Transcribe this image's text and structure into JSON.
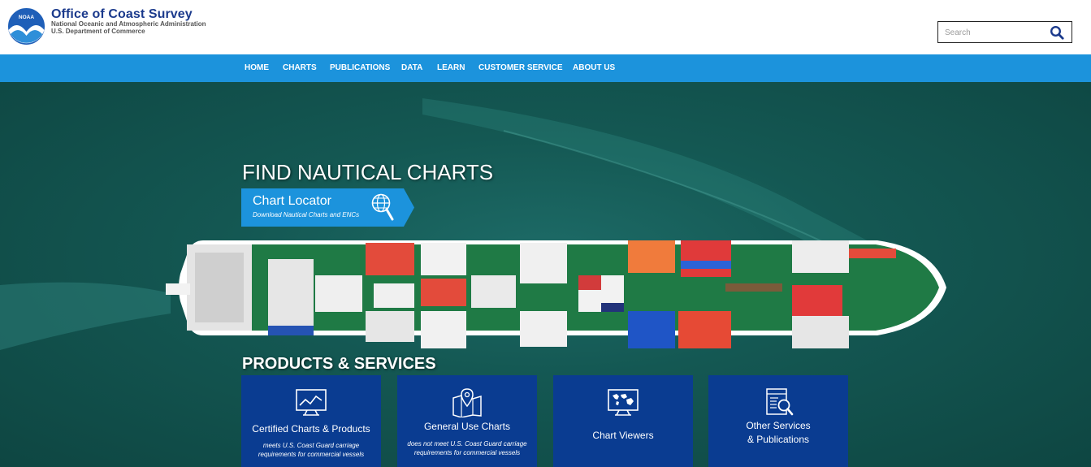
{
  "header": {
    "logo_text": "NOAA",
    "title": "Office of Coast Survey",
    "subtitle_line1": "National Oceanic and Atmospheric Administration",
    "subtitle_line2": "U.S. Department of Commerce",
    "search": {
      "placeholder": "Search",
      "value": "",
      "icon": "search-icon"
    }
  },
  "nav": {
    "items": [
      {
        "label": "HOME"
      },
      {
        "label": "CHARTS"
      },
      {
        "label": "PUBLICATIONS"
      },
      {
        "label": "DATA"
      },
      {
        "label": "LEARN"
      },
      {
        "label": "CUSTOMER SERVICE"
      },
      {
        "label": "ABOUT US"
      }
    ]
  },
  "hero": {
    "heading": "FIND NAUTICAL CHARTS",
    "locator": {
      "title": "Chart Locator",
      "subtitle": "Download Nautical Charts and ENCs",
      "icon": "globe-magnifier-icon"
    }
  },
  "products": {
    "heading": "PRODUCTS & SERVICES",
    "cards": [
      {
        "title": "Certified Charts & Products",
        "desc": "meets U.S. Coast Guard carriage requirements for commercial vessels",
        "icon": "monitor-chart-icon"
      },
      {
        "title": "General Use Charts",
        "desc": "does not meet U.S. Coast Guard carriage requirements for commercial vessels",
        "icon": "map-pin-icon"
      },
      {
        "title": "Chart Viewers",
        "desc": "",
        "icon": "monitor-world-icon"
      },
      {
        "title_line1": "Other Services",
        "title_line2": "& Publications",
        "desc": "",
        "icon": "document-search-icon"
      }
    ]
  },
  "colors": {
    "brand_blue": "#1b3a8c",
    "nav_bg": "#1c93dc",
    "locator_bg": "#1c93dc",
    "card_bg": "#0a3c91",
    "water": "#145853"
  }
}
